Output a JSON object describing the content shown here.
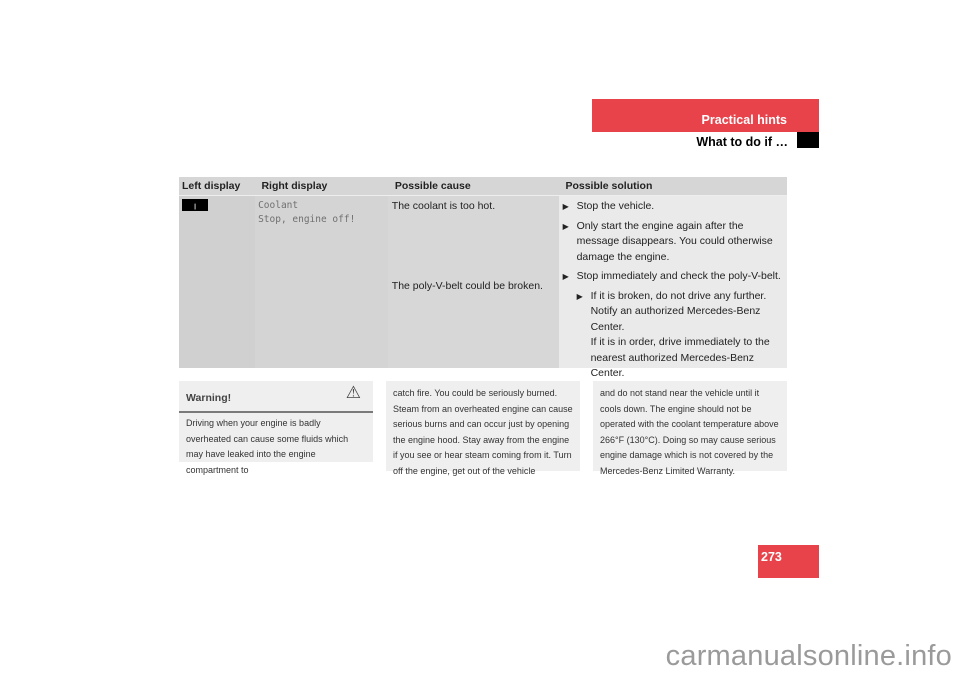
{
  "header": {
    "section": "Practical hints",
    "subsection": "What to do if …"
  },
  "table": {
    "columns": [
      "Left display",
      "Right display",
      "Possible cause",
      "Possible solution"
    ],
    "row": {
      "left_display_icon": "coolant-temperature-icon",
      "left_display_glyph": "Ⅱ",
      "right_display": [
        "Coolant",
        "Stop, engine off!"
      ],
      "causes": [
        "The coolant is too hot.",
        "The poly-V-belt could be broken."
      ],
      "solutions": [
        "Stop the vehicle.",
        "Only start the engine again after the message disappears. You could otherwise damage the engine.",
        "Stop immediately and check the poly-V-belt."
      ],
      "sub_solution": [
        "If it is broken, do not drive any further. Notify an authorized Mercedes-Benz Center.",
        "If it is in order, drive immediately to the nearest authorized Mercedes-Benz Center."
      ]
    }
  },
  "warning": {
    "title": "Warning!",
    "icon": "warning-triangle-icon",
    "text_col1": "Driving when your engine is badly overheated can cause some fluids which may have leaked into the engine compartment to",
    "text_col2": "catch fire. You could be seriously burned. Steam from an overheated engine can cause serious burns and can occur just by opening the engine hood. Stay away from the engine if you see or hear steam coming from it. Turn off the engine, get out of the vehicle",
    "text_col3": "and do not stand near the vehicle until it cools down. The engine should not be operated with the coolant temperature above 266°F (130°C). Doing so may cause serious engine damage which is not covered by the Mercedes-Benz Limited Warranty."
  },
  "page_number": "273",
  "watermark": "carmanualsonline.info",
  "colors": {
    "accent": "#e8434b"
  }
}
